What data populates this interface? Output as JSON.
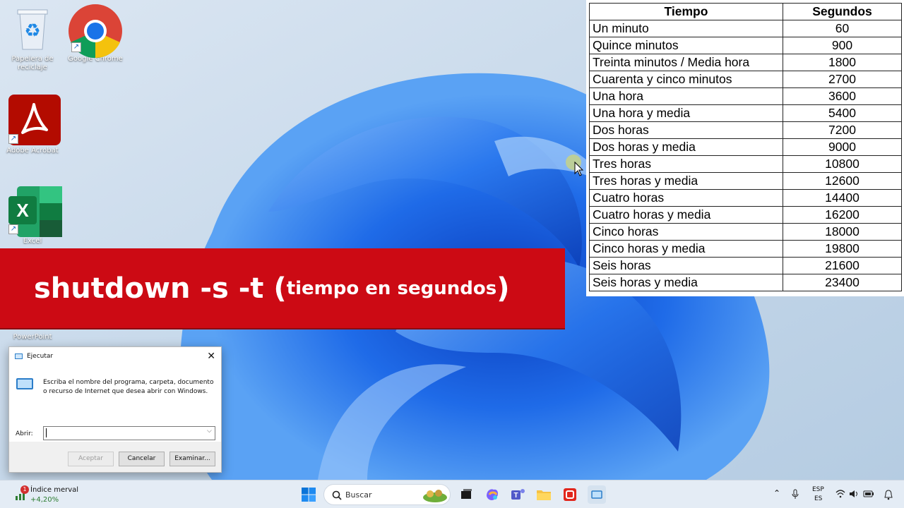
{
  "desktop": {
    "icons": [
      {
        "label": "Papelera de reciclaje",
        "icon": "recycle-bin-icon"
      },
      {
        "label": "Google Chrome",
        "icon": "chrome-icon"
      },
      {
        "label": "Adobe Acrobat",
        "icon": "acrobat-icon"
      },
      {
        "label": "Excel",
        "icon": "excel-icon"
      },
      {
        "label": "PowerPoint",
        "icon": "powerpoint-icon"
      }
    ]
  },
  "table": {
    "headers": [
      "Tiempo",
      "Segundos"
    ],
    "rows": [
      [
        "Un minuto",
        "60"
      ],
      [
        "Quince minutos",
        "900"
      ],
      [
        "Treinta minutos / Media hora",
        "1800"
      ],
      [
        "Cuarenta y cinco minutos",
        "2700"
      ],
      [
        "Una hora",
        "3600"
      ],
      [
        "Una hora y media",
        "5400"
      ],
      [
        "Dos horas",
        "7200"
      ],
      [
        "Dos horas y media",
        "9000"
      ],
      [
        "Tres horas",
        "10800"
      ],
      [
        "Tres horas y media",
        "12600"
      ],
      [
        "Cuatro horas",
        "14400"
      ],
      [
        "Cuatro horas y media",
        "16200"
      ],
      [
        "Cinco horas",
        "18000"
      ],
      [
        "Cinco horas y media",
        "19800"
      ],
      [
        "Seis horas",
        "21600"
      ],
      [
        "Seis horas y media",
        "23400"
      ]
    ]
  },
  "banner": {
    "command": "shutdown -s -t",
    "open_paren": "(",
    "subtitle": "tiempo en segundos",
    "close_paren": ")",
    "color": "#cc0a14"
  },
  "run_dialog": {
    "title": "Ejecutar",
    "description": "Escriba el nombre del programa, carpeta, documento o recurso de Internet que desea abrir con Windows.",
    "open_label": "Abrir:",
    "input_value": "",
    "buttons": {
      "ok": "Aceptar",
      "cancel": "Cancelar",
      "browse": "Examinar..."
    }
  },
  "taskbar": {
    "widget": {
      "title": "Índice merval",
      "value": "+4,20%",
      "badge": "1"
    },
    "search_placeholder": "Buscar",
    "apps": [
      "start-icon",
      "copilot-landscape-icon",
      "task-view-icon",
      "copilot-icon",
      "teams-icon",
      "file-explorer-icon",
      "powerpoint-red-icon",
      "run-icon"
    ],
    "tray": {
      "lang_top": "ESP",
      "lang_bottom": "ES"
    }
  }
}
